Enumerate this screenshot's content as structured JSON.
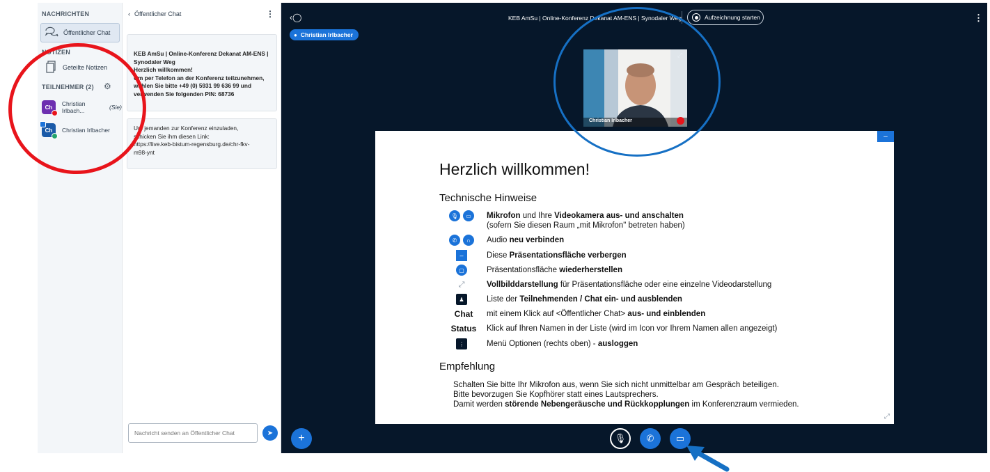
{
  "sidebar": {
    "messages_title": "NACHRICHTEN",
    "public_chat_label": "Öffentlicher Chat",
    "notes_title": "NOTIZEN",
    "shared_notes_label": "Geteilte Notizen",
    "participants_title": "TEILNEHMER (2)",
    "users": [
      {
        "initials": "Ch",
        "name": "Christian Irlbach...",
        "suffix": "(Sie)"
      },
      {
        "initials": "Ch",
        "name": "Christian Irlbacher",
        "suffix": ""
      }
    ]
  },
  "chat": {
    "back_label": "Öffentlicher Chat",
    "more_icon": "⋮",
    "welcome_line1": "KEB AmSu | Online-Konferenz Dekanat AM-ENS |",
    "welcome_line2": "Synodaler Weg",
    "welcome_line3": "Herzlich willkommen!",
    "welcome_line4": "Um per Telefon an der Konferenz teilzunehmen,",
    "welcome_line5": "wählen Sie bitte +49 (0) 5931 99 636 99 und",
    "welcome_line6": "verwenden Sie folgenden PIN: 68736",
    "invite_line1": "Um jemanden zur Konferenz einzuladen,",
    "invite_line2": "schicken Sie ihm diesen Link:",
    "invite_line3": "https://live.keb-bistum-regensburg.de/chr-fkv-",
    "invite_line4": "m98-ynt",
    "input_placeholder": "Nachricht senden an Öffentlicher Chat"
  },
  "topbar": {
    "title": "KEB AmSu | Online-Konferenz Dekanat AM-ENS | Synodaler Weg",
    "record_label": "Aufzeichnung starten",
    "talking_badge": "Christian Irlbacher"
  },
  "video": {
    "name_label": "Christian Irlbacher"
  },
  "presentation": {
    "heading": "Herzlich willkommen!",
    "sub1": "Technische Hinweise",
    "rows": [
      {
        "bold1": "Mikrofon",
        "t1": " und Ihre ",
        "bold2": "Videokamera aus- und anschalten",
        "line2": "(sofern Sie diesen Raum „mit Mikrofon\" betreten haben)"
      },
      {
        "t0": "Audio ",
        "bold1": "neu verbinden"
      },
      {
        "t0": "Diese ",
        "bold1": "Präsentationsfläche verbergen"
      },
      {
        "t0": "Präsentationsfläche ",
        "bold1": "wiederherstellen"
      },
      {
        "bold1": "Vollbilddarstellung",
        "t1": " für Präsentationsfläche oder eine einzelne Videodarstellung"
      },
      {
        "t0": "Liste der ",
        "bold1": "Teilnehmenden / Chat ein- und ausblenden"
      },
      {
        "label": "Chat",
        "t0": "mit einem Klick auf <Öffentlicher Chat> ",
        "bold1": "aus- und einblenden"
      },
      {
        "label": "Status",
        "t0": "Klick auf Ihren Namen in der Liste (wird im Icon vor Ihrem Namen allen angezeigt)"
      },
      {
        "t0": "Menü Optionen (rechts oben) - ",
        "bold1": "ausloggen"
      }
    ],
    "sub2": "Empfehlung",
    "rec_line1": "Schalten Sie bitte Ihr Mikrofon aus, wenn Sie sich nicht unmittelbar am Gespräch beteiligen.",
    "rec_line2": "Bitte bevorzugen Sie Kopfhörer statt eines Lautsprechers.",
    "rec_line3_a": "Damit werden ",
    "rec_line3_b": "störende Nebengeräusche und Rückkopplungen",
    "rec_line3_c": " im Konferenzraum vermieden."
  },
  "colors": {
    "accent": "#1b73d9",
    "dark_bg": "#06172a",
    "annotation_red": "#e8141b",
    "annotation_blue": "#1670c4"
  }
}
